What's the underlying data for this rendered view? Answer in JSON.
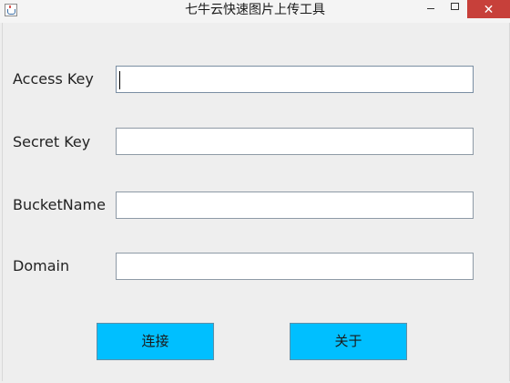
{
  "window": {
    "title": "七牛云快速图片上传工具",
    "close_symbol": "✕"
  },
  "form": {
    "fields": [
      {
        "label": "Access Key",
        "value": ""
      },
      {
        "label": "Secret Key",
        "value": ""
      },
      {
        "label": "BucketName",
        "value": ""
      },
      {
        "label": "Domain",
        "value": ""
      }
    ]
  },
  "buttons": {
    "connect_label": "连接",
    "about_label": "关于"
  },
  "colors": {
    "button_bg": "#00bfff",
    "close_bg": "#c7403a",
    "window_bg": "#eeeeee"
  },
  "icons": {
    "app": "java-cup-icon",
    "minimize": "minimize-icon",
    "maximize": "maximize-icon",
    "close": "close-icon"
  }
}
